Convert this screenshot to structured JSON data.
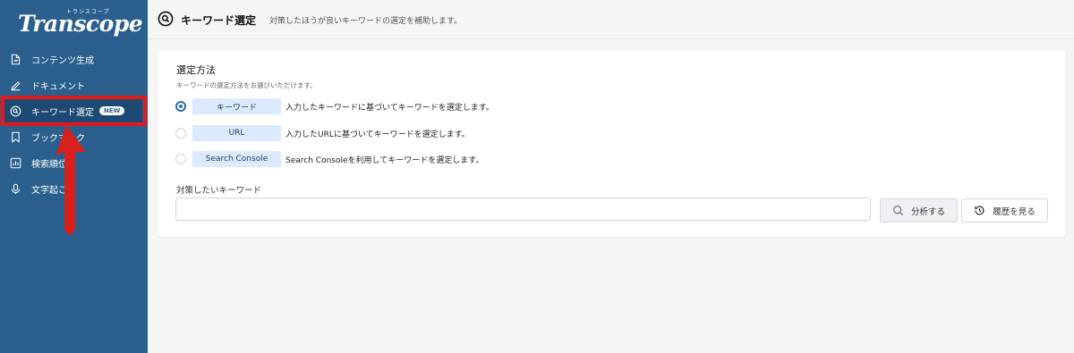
{
  "app": {
    "logo_ruby": "トランスコープ",
    "logo_text": "Transcope"
  },
  "sidebar": {
    "items": [
      {
        "label": "コンテンツ生成",
        "icon": "document-icon"
      },
      {
        "label": "ドキュメント",
        "icon": "edit-icon"
      },
      {
        "label": "キーワード選定",
        "icon": "search-icon",
        "badge": "NEW",
        "active": true
      },
      {
        "label": "ブックマーク",
        "icon": "bookmark-icon"
      },
      {
        "label": "検索順位",
        "icon": "bar-chart-icon"
      },
      {
        "label": "文字起こし",
        "icon": "microphone-icon"
      }
    ]
  },
  "header": {
    "title": "キーワード選定",
    "subtitle": "対策したほうが良いキーワードの選定を補助します。"
  },
  "card": {
    "section_title": "選定方法",
    "section_desc": "キーワードの選定方法をお選びいただけます。",
    "options": [
      {
        "chip": "キーワード",
        "desc": "入力したキーワードに基づいてキーワードを選定します。",
        "selected": true
      },
      {
        "chip": "URL",
        "desc": "入力したURLに基づいてキーワードを選定します。",
        "selected": false
      },
      {
        "chip": "Search Console",
        "desc": "Search Consoleを利用してキーワードを選定します。",
        "selected": false
      }
    ],
    "keyword_label": "対策したいキーワード",
    "keyword_value": "",
    "keyword_placeholder": "",
    "analyze_label": "分析する",
    "history_label": "履歴を見る"
  },
  "colors": {
    "sidebar_bg": "#2b5f8e",
    "highlight": "#e21a1a",
    "chip_bg": "#dbeafe",
    "accent": "#2b6cb0"
  }
}
